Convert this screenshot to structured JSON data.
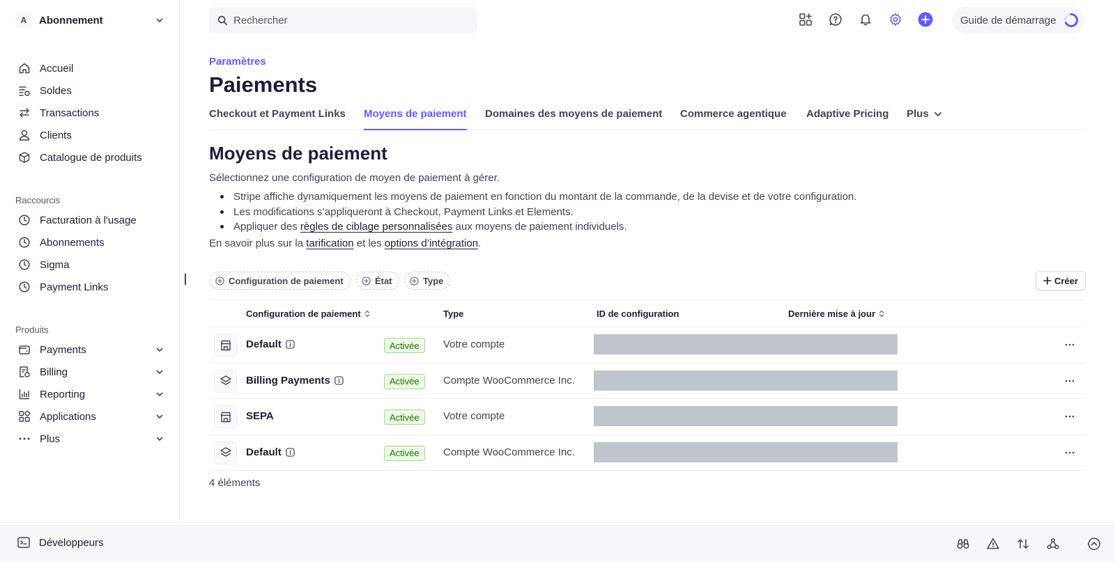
{
  "account": {
    "initial": "A",
    "name": "Abonnement"
  },
  "search": {
    "placeholder": "Rechercher"
  },
  "guide": {
    "label": "Guide de démarrage"
  },
  "nav": {
    "main": [
      {
        "label": "Accueil",
        "icon": "home-icon"
      },
      {
        "label": "Soldes",
        "icon": "balances-icon"
      },
      {
        "label": "Transactions",
        "icon": "transactions-icon"
      },
      {
        "label": "Clients",
        "icon": "customer-icon"
      },
      {
        "label": "Catalogue de produits",
        "icon": "box-icon"
      }
    ],
    "shortcuts_title": "Raccourcis",
    "shortcuts": [
      {
        "label": "Facturation à l'usage",
        "icon": "clock-icon"
      },
      {
        "label": "Abonnements",
        "icon": "clock-icon"
      },
      {
        "label": "Sigma",
        "icon": "clock-icon"
      },
      {
        "label": "Payment Links",
        "icon": "clock-icon"
      }
    ],
    "products_title": "Produits",
    "products": [
      {
        "label": "Payments",
        "icon": "wallet-icon"
      },
      {
        "label": "Billing",
        "icon": "billing-icon"
      },
      {
        "label": "Reporting",
        "icon": "chart-icon"
      },
      {
        "label": "Applications",
        "icon": "apps-icon"
      },
      {
        "label": "Plus",
        "icon": "more-icon"
      }
    ]
  },
  "header": {
    "breadcrumb": "Paramètres",
    "title": "Paiements",
    "tabs": [
      {
        "label": "Checkout et Payment Links",
        "active": false
      },
      {
        "label": "Moyens de paiement",
        "active": true
      },
      {
        "label": "Domaines des moyens de paiement",
        "active": false
      },
      {
        "label": "Commerce agentique",
        "active": false
      },
      {
        "label": "Adaptive Pricing",
        "active": false
      },
      {
        "label": "Plus",
        "active": false
      }
    ]
  },
  "section": {
    "title": "Moyens de paiement",
    "description": "Sélectionnez une configuration de moyen de paiement à gérer.",
    "bullets": [
      "Stripe affiche dynamiquement les moyens de paiement en fonction du montant de la commande, de la devise et de votre configuration.",
      "Les modifications s’appliqueront à Checkout, Payment Links et Elements.",
      {
        "before": "Appliquer des ",
        "link": "règles de ciblage personnalisées",
        "after": " aux moyens de paiement individuels."
      }
    ],
    "learn_more": {
      "prefix": "En savoir plus sur la ",
      "link1": "tarification",
      "middle": " et les ",
      "link2": "options d’intégration",
      "suffix": "."
    }
  },
  "filters": [
    "Configuration de paiement",
    "État",
    "Type"
  ],
  "create_label": "Créer",
  "table": {
    "columns": [
      "Configuration de paiement",
      "Type",
      "ID de configuration",
      "Dernière mise à jour"
    ],
    "rows": [
      {
        "name": "Default",
        "info": true,
        "status": "Activée",
        "type": "Votre compte",
        "icon": "store-icon"
      },
      {
        "name": "Billing Payments",
        "info": true,
        "status": "Activée",
        "type": "Compte WooCommerce Inc.",
        "icon": "layers-icon"
      },
      {
        "name": "SEPA",
        "info": false,
        "status": "Activée",
        "type": "Votre compte",
        "icon": "store-icon"
      },
      {
        "name": "Default",
        "info": true,
        "status": "Activée",
        "type": "Compte WooCommerce Inc.",
        "icon": "layers-icon"
      }
    ],
    "count": "4 éléments"
  },
  "bottom": {
    "developers": "Développeurs"
  },
  "colors": {
    "accent": "#635bff",
    "success_bg": "#ecfbe6",
    "success_text": "#217005"
  }
}
